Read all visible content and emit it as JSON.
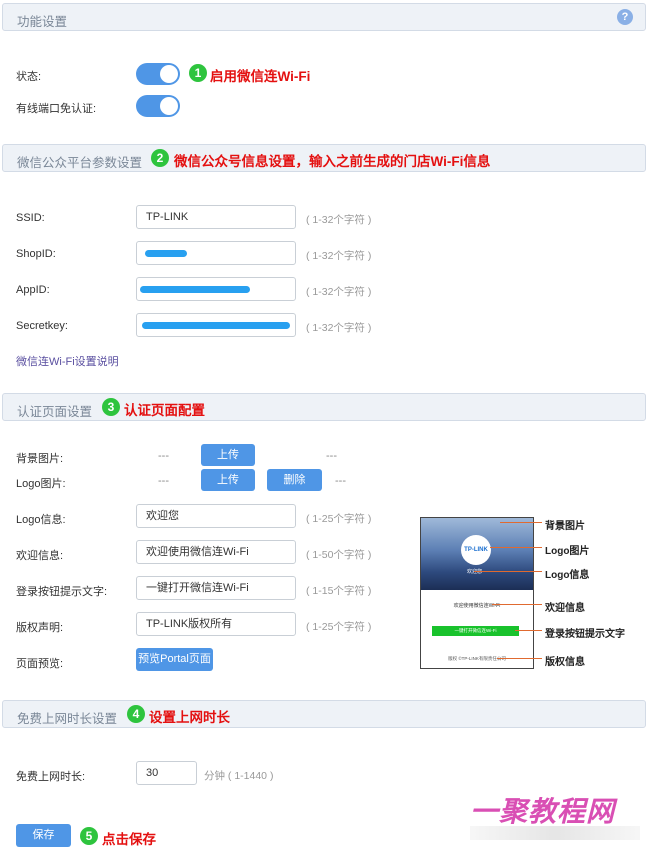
{
  "sections": {
    "feature": {
      "title": "功能设置"
    },
    "wechat": {
      "title": "微信公众平台参数设置"
    },
    "auth": {
      "title": "认证页面设置"
    },
    "free": {
      "title": "免费上网时长设置"
    }
  },
  "annotations": {
    "step1": {
      "num": "1",
      "text": "启用微信连Wi-Fi"
    },
    "step2": {
      "num": "2",
      "text": "微信公众号信息设置，输入之前生成的门店Wi-Fi信息"
    },
    "step3": {
      "num": "3",
      "text": "认证页面配置"
    },
    "step4": {
      "num": "4",
      "text": "设置上网时长"
    },
    "step5": {
      "num": "5",
      "text": "点击保存"
    }
  },
  "feature": {
    "help_icon": "?",
    "status_label": "状态:",
    "status_on": true,
    "wired_label": "有线端口免认证:",
    "wired_on": true
  },
  "wechat": {
    "ssid_label": "SSID:",
    "ssid_value": "TP-LINK",
    "ssid_hint": "( 1-32个字符 )",
    "shopid_label": "ShopID:",
    "shopid_hint": "( 1-32个字符 )",
    "appid_label": "AppID:",
    "appid_hint": "( 1-32个字符 )",
    "secretkey_label": "Secretkey:",
    "secretkey_hint": "( 1-32个字符 )",
    "help_link": "微信连Wi-Fi设置说明"
  },
  "auth": {
    "bg_label": "背景图片:",
    "bg_dash": "---",
    "bg_upload": "上传",
    "bg_file": "---",
    "logo_label": "Logo图片:",
    "logo_dash": "---",
    "logo_upload": "上传",
    "logo_delete": "删除",
    "logo_file": "---",
    "logoinfo_label": "Logo信息:",
    "logoinfo_value": "欢迎您",
    "logoinfo_hint": "( 1-25个字符 )",
    "welcome_label": "欢迎信息:",
    "welcome_value": "欢迎使用微信连Wi-Fi",
    "welcome_hint": "( 1-50个字符 )",
    "loginbtn_label": "登录按钮提示文字:",
    "loginbtn_value": "一键打开微信连Wi-Fi",
    "loginbtn_hint": "( 1-15个字符 )",
    "copyright_label": "版权声明:",
    "copyright_value": "TP-LINK版权所有",
    "copyright_hint": "( 1-25个字符 )",
    "preview_label": "页面预览:",
    "preview_button": "预览Portal页面"
  },
  "preview": {
    "logo_text": "TP-LINK",
    "logo_info": "欢迎您",
    "welcome": "欢迎使用微信连Wi-Fi",
    "login": "一键打开微信连Wi-Fi",
    "copyright": "版权 ©TP-LINK有限责任公司",
    "callouts": {
      "bg": "背景图片",
      "logo": "Logo图片",
      "logo_info": "Logo信息",
      "welcome": "欢迎信息",
      "login": "登录按钮提示文字",
      "copyright": "版权信息"
    }
  },
  "free": {
    "duration_label": "免费上网时长:",
    "duration_value": "30",
    "duration_hint": "分钟 ( 1-1440 )"
  },
  "save_button": "保存",
  "watermark": "一聚教程网",
  "colors": {
    "accent": "#4f96e6",
    "badge": "#2ec43e",
    "annotation": "#e41010"
  }
}
